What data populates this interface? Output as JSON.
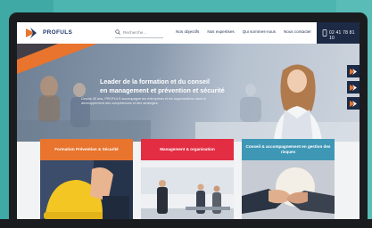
{
  "site": {
    "logo_text": "PROFULS",
    "search": {
      "placeholder": "Recherche..."
    },
    "nav": [
      {
        "label": "Nos objectifs"
      },
      {
        "label": "Nos expertises"
      },
      {
        "label": "Qui sommes-nous"
      },
      {
        "label": "Nous contacter"
      }
    ],
    "phone": "02 41 78 81 10"
  },
  "hero": {
    "title_line1": "Leader de la formation et du conseil",
    "title_line2": "en management et prévention et sécurité",
    "subtitle": "Depuis 30 ans, PROFULS accompagne les entreprises et les organisations dans le développement des compétences et des stratégies."
  },
  "cards": [
    {
      "label": "Formation Prévention & Sécurité",
      "color": "#e8742d"
    },
    {
      "label": "Management & organisation",
      "color": "#e22d42"
    },
    {
      "label": "Conseil & accompagnement en gestion des risques",
      "color": "#3f97b6"
    }
  ],
  "colors": {
    "navy": "#1c2a45",
    "orange": "#e8742d",
    "red": "#e22d42",
    "teal": "#4db5b0"
  }
}
